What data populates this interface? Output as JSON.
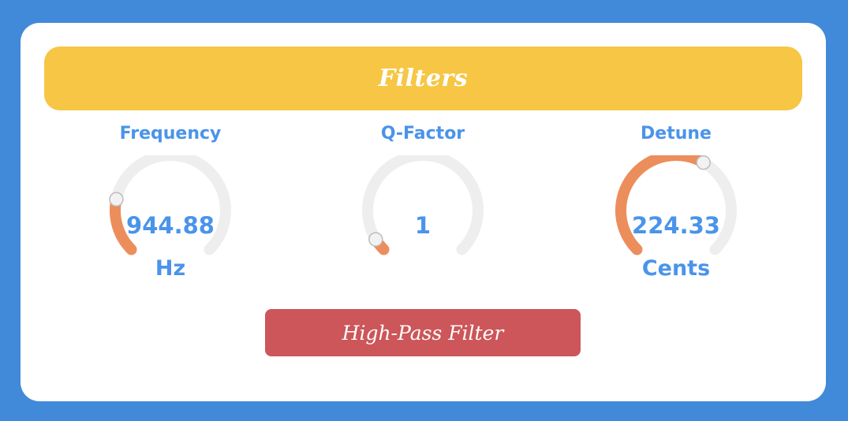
{
  "header": {
    "title": "Filters"
  },
  "knobs": [
    {
      "label": "Frequency",
      "value": "944.88",
      "unit": "Hz",
      "fraction": 0.21
    },
    {
      "label": "Q-Factor",
      "value": "1",
      "unit": "",
      "fraction": 0.05
    },
    {
      "label": "Detune",
      "value": "224.33",
      "unit": "Cents",
      "fraction": 0.61
    }
  ],
  "filter_button": {
    "label": "High-Pass Filter"
  },
  "colors": {
    "background": "#4189d9",
    "panel": "#ffffff",
    "header": "#f6c644",
    "accent_text": "#4a94ea",
    "knob_track": "#eeeeee",
    "knob_fill": "#ec8e5c",
    "button": "#cc5659"
  }
}
